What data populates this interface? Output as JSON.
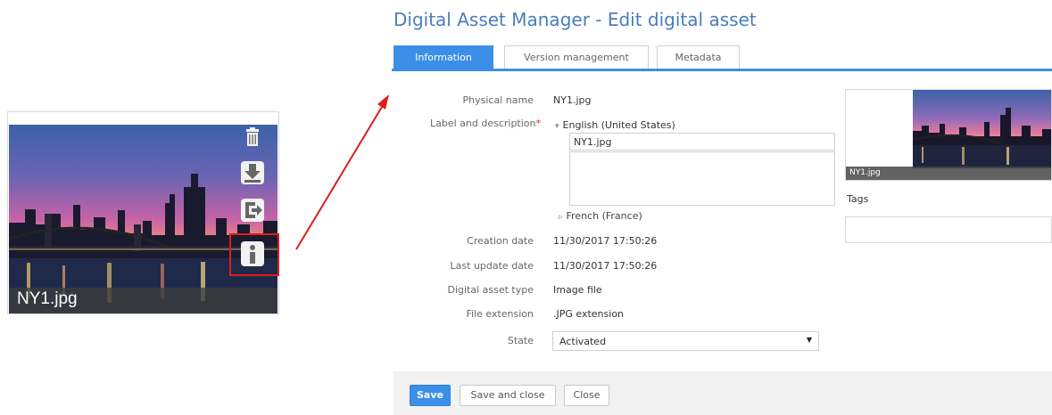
{
  "thumbnail": {
    "filename": "NY1.jpg",
    "icons": [
      "trash-icon",
      "download-icon",
      "export-icon",
      "info-icon"
    ]
  },
  "editor": {
    "title": "Digital Asset Manager - Edit digital asset",
    "tabs": [
      {
        "label": "Information",
        "active": true
      },
      {
        "label": "Version management",
        "active": false
      },
      {
        "label": "Metadata",
        "active": false
      }
    ],
    "fields": {
      "physical_name": {
        "label": "Physical name",
        "value": "NY1.jpg"
      },
      "label_description": {
        "label": "Label and description",
        "required_mark": "*",
        "languages": [
          {
            "name": "English (United States)",
            "expanded": true,
            "label_value": "NY1.jpg",
            "description_value": ""
          },
          {
            "name": "French (France)",
            "expanded": false
          }
        ]
      },
      "creation_date": {
        "label": "Creation date",
        "value": "11/30/2017 17:50:26"
      },
      "last_update_date": {
        "label": "Last update date",
        "value": "11/30/2017 17:50:26"
      },
      "asset_type": {
        "label": "Digital asset type",
        "value": "Image file"
      },
      "file_extension": {
        "label": "File extension",
        "value": ".JPG extension"
      },
      "state": {
        "label": "State",
        "value": "Activated"
      }
    },
    "preview": {
      "caption": "NY1.jpg"
    },
    "tags": {
      "label": "Tags",
      "value": ""
    },
    "buttons": {
      "save": "Save",
      "save_close": "Save and close",
      "close": "Close"
    }
  },
  "colors": {
    "accent": "#3c8fe6",
    "title": "#4a7dbb",
    "highlight": "#e01c1c",
    "required": "#d9271d"
  }
}
